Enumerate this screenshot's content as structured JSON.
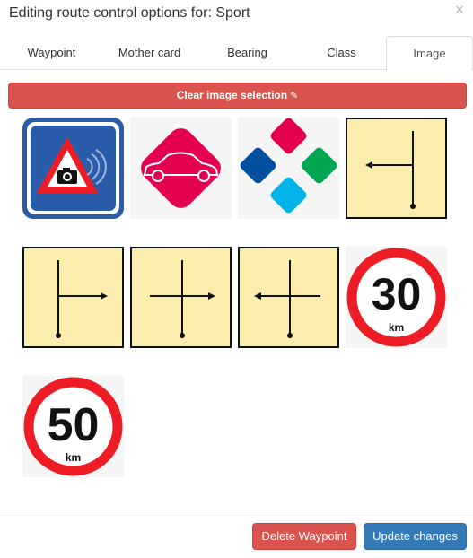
{
  "modal": {
    "title": "Editing route control options for: Sport",
    "close_label": "×"
  },
  "tabs": [
    {
      "label": "Waypoint",
      "active": false
    },
    {
      "label": "Mother card",
      "active": false
    },
    {
      "label": "Bearing",
      "active": false
    },
    {
      "label": "Class",
      "active": false
    },
    {
      "label": "Image",
      "active": true
    }
  ],
  "clear_button": {
    "label": "Clear image selection",
    "icon": "magic-wand-icon"
  },
  "images": [
    {
      "name": "speed-camera-sign-image"
    },
    {
      "name": "car-diamond-image"
    },
    {
      "name": "colored-diamonds-image"
    },
    {
      "name": "tulip-turn-left-image"
    },
    {
      "name": "tulip-turn-right-image"
    },
    {
      "name": "tulip-crossroad-straight-right-image"
    },
    {
      "name": "tulip-crossroad-straight-left-image"
    },
    {
      "name": "speed-limit-30-image",
      "number": "30",
      "unit": "km"
    },
    {
      "name": "speed-limit-50-image",
      "number": "50",
      "unit": "km"
    }
  ],
  "footer": {
    "delete_label": "Delete Waypoint",
    "update_label": "Update changes"
  },
  "colors": {
    "danger": "#d9534f",
    "primary": "#337ab7",
    "tulip_bg": "#fbeeac",
    "sign_red": "#ee1c25",
    "sign_blue": "#2a5caa",
    "car_pink": "#e4004e"
  }
}
